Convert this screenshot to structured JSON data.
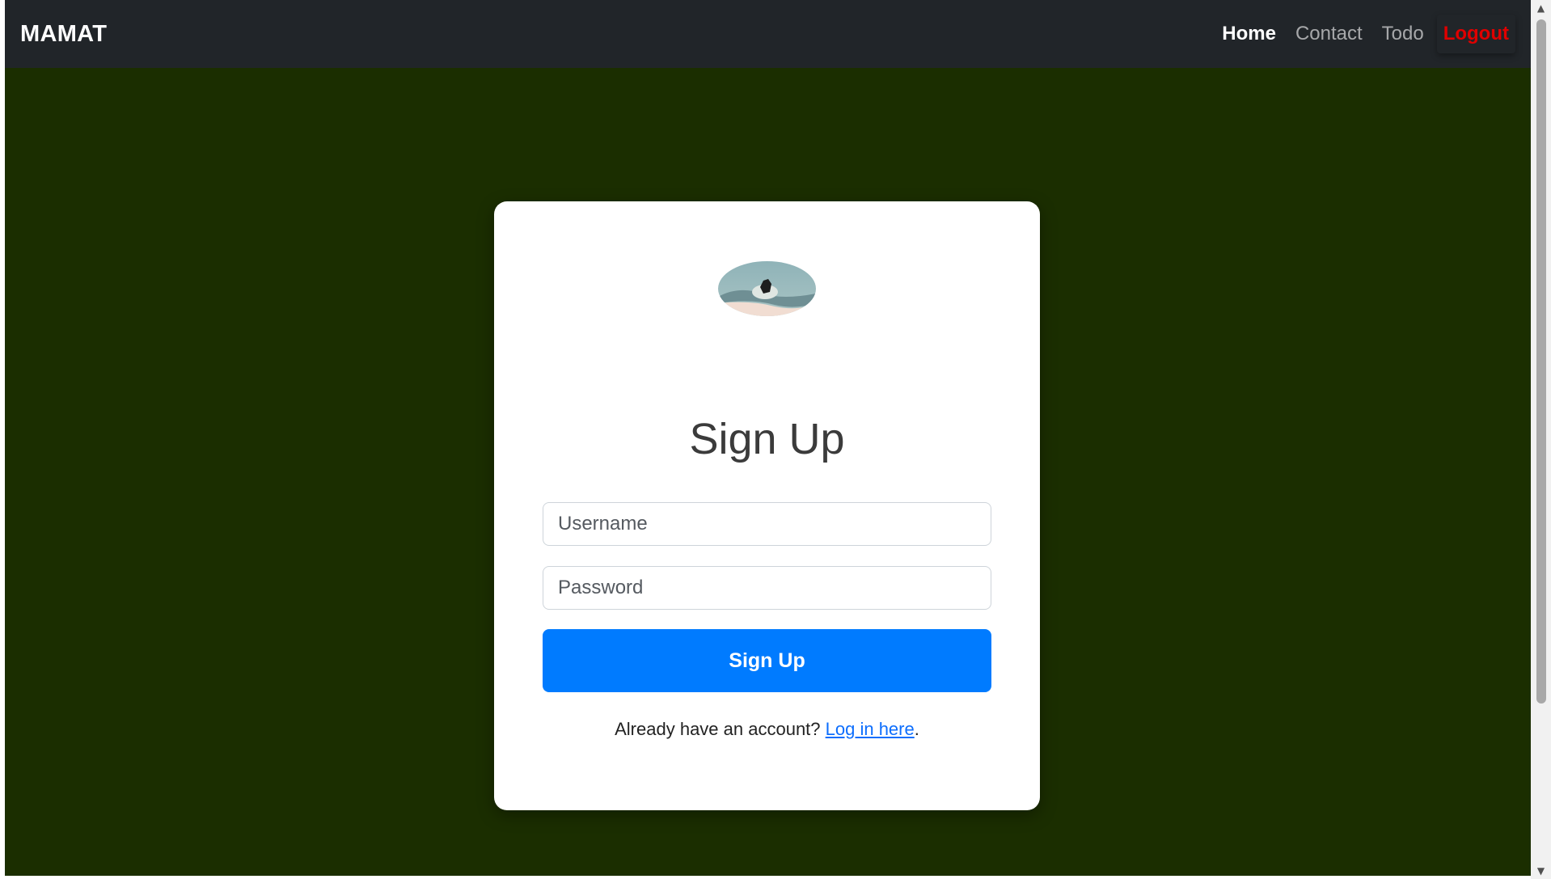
{
  "navbar": {
    "brand": "MAMAT",
    "links": [
      {
        "label": "Home"
      },
      {
        "label": "Contact"
      },
      {
        "label": "Todo"
      },
      {
        "label": "Logout"
      }
    ]
  },
  "signup": {
    "title": "Sign Up",
    "username_placeholder": "Username",
    "username_value": "",
    "password_placeholder": "Password",
    "password_value": "",
    "submit_label": "Sign Up",
    "footer_prefix": "Already have an account? ",
    "login_link": "Log in here",
    "footer_suffix": "."
  },
  "colors": {
    "navbar_bg": "#212529",
    "page_bg": "#1b2e00",
    "primary": "#007bff",
    "logout": "#e00000"
  }
}
